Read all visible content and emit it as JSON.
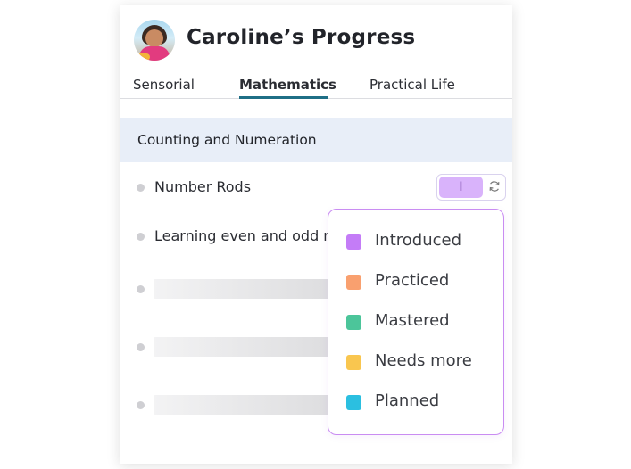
{
  "header": {
    "title": "Caroline’s Progress"
  },
  "tabs": [
    {
      "label": "Sensorial",
      "active": false
    },
    {
      "label": "Mathematics",
      "active": true
    },
    {
      "label": "Practical Life",
      "active": false
    }
  ],
  "section": {
    "label": "Counting and Numeration"
  },
  "rows": [
    {
      "label": "Number Rods",
      "status_letter": "I"
    },
    {
      "label": "Learning even and odd n"
    }
  ],
  "status_menu": {
    "options": [
      {
        "label": "Introduced",
        "color": "#c47cf7"
      },
      {
        "label": "Practiced",
        "color": "#f9a06f"
      },
      {
        "label": "Mastered",
        "color": "#4cc59a"
      },
      {
        "label": "Needs more",
        "color": "#f9c64f"
      },
      {
        "label": "Planned",
        "color": "#2bbfe0"
      }
    ]
  },
  "colors": {
    "tab_underline": "#1f6f86",
    "section_bg": "#e8eef8",
    "status_chip": "#d9b3fb",
    "dropdown_border": "#c98cf2"
  }
}
